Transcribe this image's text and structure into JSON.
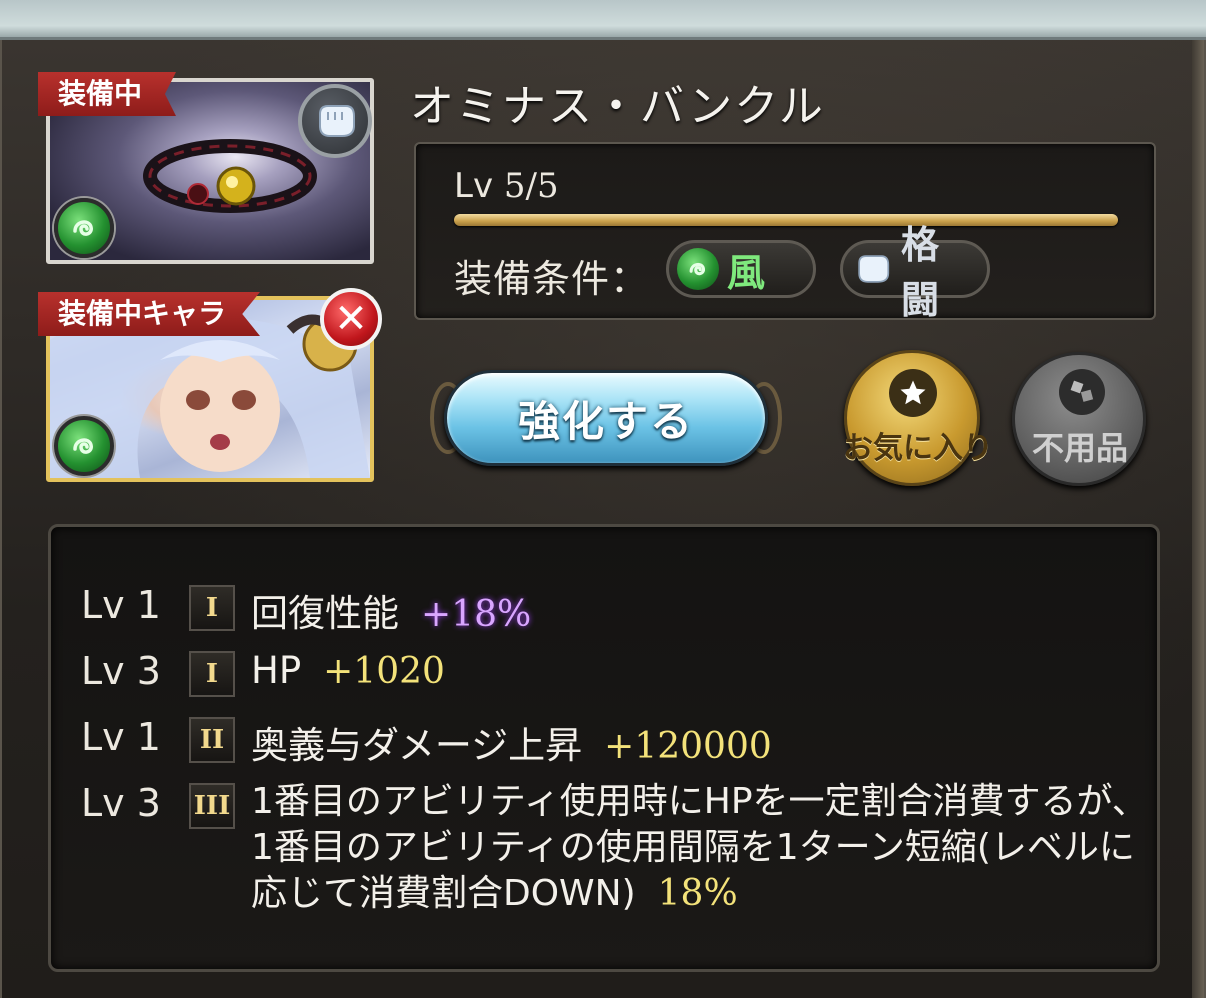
{
  "equipped_badge": "装備中",
  "equipped_char_badge": "装備中キャラ",
  "weapon": {
    "name": "オミナス・バンクル",
    "level_prefix": "Lv",
    "level": "5/5",
    "level_progress": 1.0,
    "condition_label": "装備条件：",
    "element": "風",
    "weapon_type": "格闘",
    "element_color": "#249130"
  },
  "buttons": {
    "upgrade": "強化する",
    "favorite": "お気に入り",
    "junk": "不用品"
  },
  "skills": [
    {
      "lv": "Lv 1",
      "rank": "I",
      "name": "回復性能",
      "value": "+18%"
    },
    {
      "lv": "Lv 3",
      "rank": "I",
      "name": "HP",
      "value": "+1020"
    },
    {
      "lv": "Lv 1",
      "rank": "II",
      "name": "奥義与ダメージ上昇",
      "value": "+120000"
    },
    {
      "lv": "Lv 3",
      "rank": "III",
      "name": "1番目のアビリティ使用時にHPを一定割合消費するが、1番目のアビリティの使用間隔を1ターン短縮(レベルに応じて消費割合DOWN)",
      "value": "18%"
    }
  ]
}
